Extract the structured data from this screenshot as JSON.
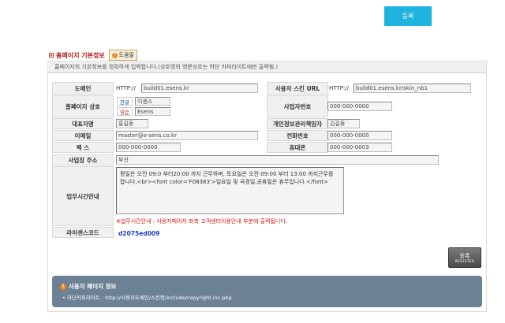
{
  "top": {
    "register_label": "등록"
  },
  "section": {
    "title": "홈페이지 기본정보",
    "help_label": "도움말",
    "help_icon": "question-icon",
    "description": "홈페이지의 기본정보를 정확하게 입력합니다.(상호명의 영문상호는 하단 카피라이트에만 출력됨.)"
  },
  "form": {
    "domain": {
      "label": "도메인",
      "prefix": "HTTP://",
      "value": "build01.esens.kr"
    },
    "skin_url": {
      "label": "사용자 스킨 URL",
      "prefix": "HTTP://",
      "value": "build01.esens.kr/skin_nb1"
    },
    "company": {
      "label": "홈페이지 상호",
      "ko_tag": "한글",
      "ko_value": "이센스",
      "en_tag": "영문",
      "en_value": "Esens"
    },
    "biz_no": {
      "label": "사업자번호",
      "value": "000-000-0000"
    },
    "ceo": {
      "label": "대표자명",
      "value": "홍길동"
    },
    "privacy_manager": {
      "label": "개인정보관리책임자",
      "value": "김길동"
    },
    "email": {
      "label": "이메일",
      "value": "master@e-sens.co.kr"
    },
    "phone": {
      "label": "전화번호",
      "value": "000-000-0000"
    },
    "fax": {
      "label": "팩 스",
      "value": "000-000-0000"
    },
    "mobile": {
      "label": "휴대폰",
      "value": "000-000-0003"
    },
    "address": {
      "label": "사업장 주소",
      "value": "부산"
    },
    "business_hours": {
      "label": "업무시간안내",
      "text": "평일은 오전 09:0 부터20:00 까지 근무하며, 토요일은 오전 09:00 부터 13:00 까지근무를 합니다.<br><font color='F08383'>일요일 및 국경일,공휴일은 휴무입니다.</font>",
      "note": "※업무시간안내 : 사용자페이지 좌측 고객센터이용안내 부분에 출력됩니다."
    },
    "license": {
      "label": "라이센스코드",
      "value": "d2075ed009"
    }
  },
  "register_button": {
    "label": "등록",
    "sub": "REGISTER"
  },
  "info": {
    "title": "사용자 페이지 정보",
    "icon": "info-icon",
    "text": "• 하단카피라이트 : http://사용자도메인/스킨명/include/copyright.inc.php"
  },
  "colors": {
    "accent": "#1fb3df",
    "section_title": "#b31d1d",
    "note": "#dd1111",
    "license": "#1a3fbd",
    "info_bg": "#6d8195"
  }
}
